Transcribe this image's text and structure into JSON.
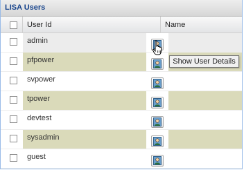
{
  "panel": {
    "title": "LISA Users"
  },
  "columns": {
    "user_id": "User Id",
    "name": "Name"
  },
  "rows": [
    {
      "user_id": "admin",
      "name": ""
    },
    {
      "user_id": "pfpower",
      "name": ""
    },
    {
      "user_id": "svpower",
      "name": ""
    },
    {
      "user_id": "tpower",
      "name": ""
    },
    {
      "user_id": "devtest",
      "name": ""
    },
    {
      "user_id": "sysadmin",
      "name": ""
    },
    {
      "user_id": "guest",
      "name": ""
    }
  ],
  "tooltip": {
    "text": "Show User Details"
  },
  "icons": {
    "row_button": "user-details-icon",
    "cursor": "hand-pointer-icon"
  },
  "colors": {
    "title": "#15428b",
    "alt_row": "#dadaba",
    "border": "#99bbe8"
  }
}
